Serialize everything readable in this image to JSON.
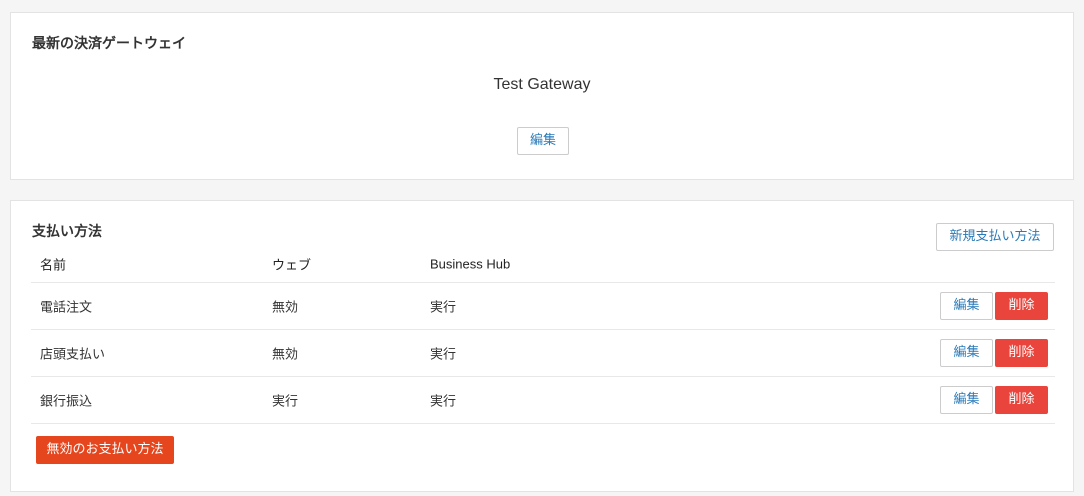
{
  "gateway_section": {
    "title": "最新の決済ゲートウェイ",
    "gateway_name": "Test Gateway",
    "edit_label": "編集"
  },
  "methods_section": {
    "title": "支払い方法",
    "new_button_label": "新規支払い方法",
    "columns": {
      "name": "名前",
      "web": "ウェブ",
      "business_hub": "Business Hub"
    },
    "rows": [
      {
        "name": "電話注文",
        "web": "無効",
        "business_hub": "実行",
        "edit_label": "編集",
        "delete_label": "削除"
      },
      {
        "name": "店頭支払い",
        "web": "無効",
        "business_hub": "実行",
        "edit_label": "編集",
        "delete_label": "削除"
      },
      {
        "name": "銀行振込",
        "web": "実行",
        "business_hub": "実行",
        "edit_label": "編集",
        "delete_label": "削除"
      }
    ],
    "disabled_methods_label": "無効のお支払い方法"
  },
  "colors": {
    "link_blue": "#2a7ab8",
    "danger_red": "#e9453c",
    "orange": "#e5461d"
  }
}
